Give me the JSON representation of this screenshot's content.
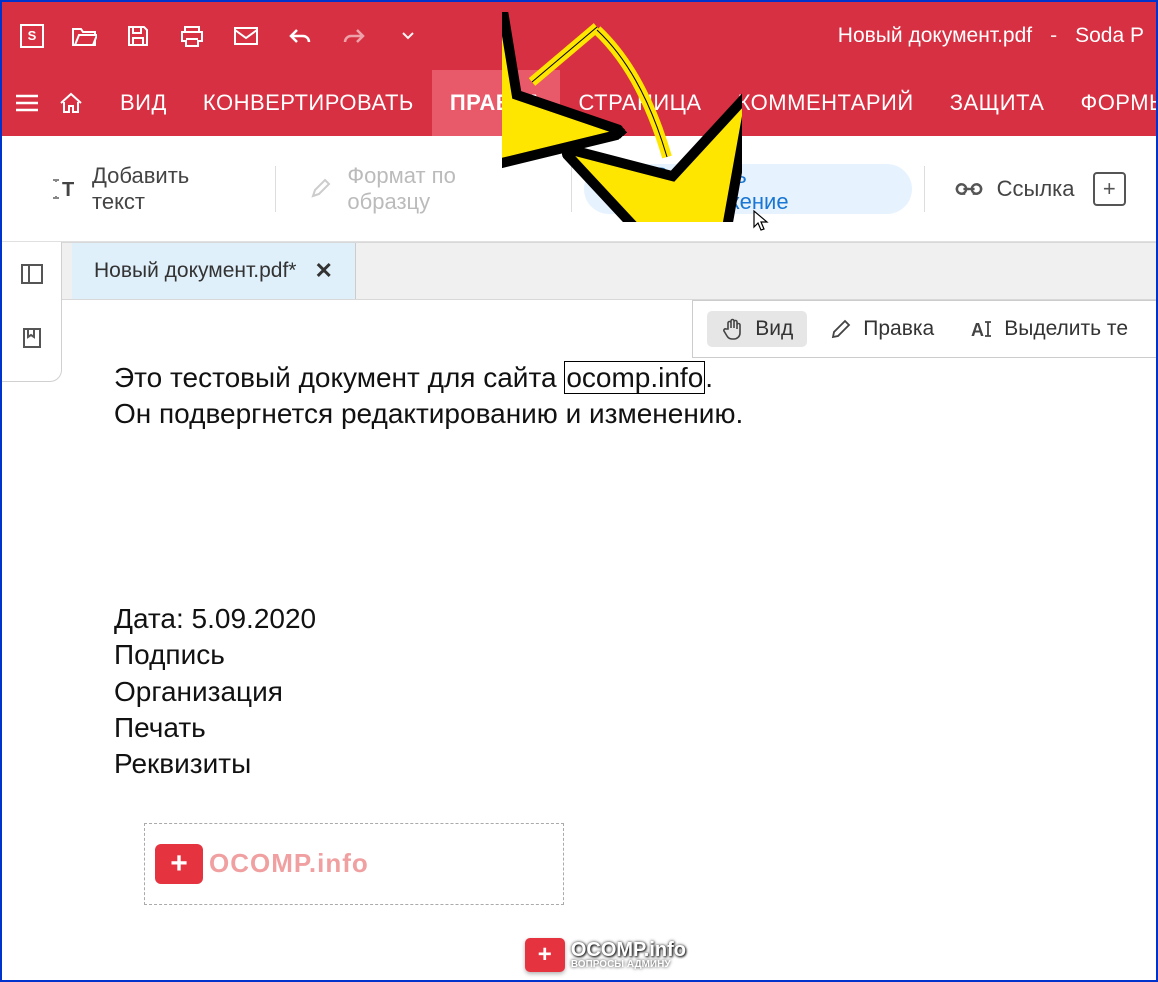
{
  "titlebar": {
    "doc_title": "Новый документ.pdf",
    "separator": "-",
    "app_name": "Soda P",
    "logo_letter": "S"
  },
  "menubar": {
    "items": [
      "ВИД",
      "КОНВЕРТИРОВАТЬ",
      "ПРАВКА",
      "СТРАНИЦА",
      "КОММЕНТАРИЙ",
      "ЗАЩИТА",
      "ФОРМЫ"
    ],
    "active_index": 2
  },
  "ribbon": {
    "add_text": "Добавить текст",
    "format_painter": "Формат по образцу",
    "insert_image": "Вставить изображение",
    "link": "Ссылка"
  },
  "tab": {
    "label": "Новый документ.pdf*"
  },
  "modes": {
    "view": "Вид",
    "edit": "Правка",
    "select_text": "Выделить те"
  },
  "document": {
    "line1_part1": "Это тестовый документ для сайта ",
    "line1_boxed": "ocomp.info",
    "line1_part2": ".",
    "line2": "Он подвергнется редактированию и изменению.",
    "date_label": "Дата: 5.09.2020",
    "signature": "Подпись",
    "organization": "Организация",
    "stamp": "Печать",
    "requisites": "Реквизиты",
    "logo_text": "OCOMP.info"
  },
  "watermark": {
    "main": "OCOMP.info",
    "sub": "ВОПРОСЫ АДМИНУ"
  }
}
